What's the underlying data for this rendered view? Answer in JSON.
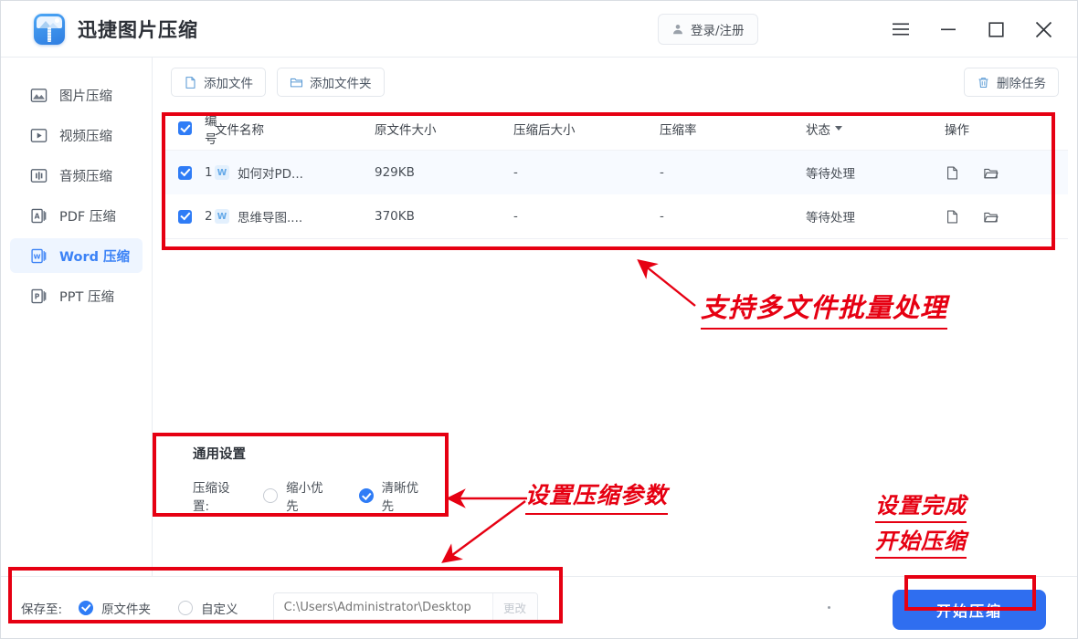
{
  "window": {
    "app_title": "迅捷图片压缩",
    "app_icon": "image-compress-app-icon",
    "login_label": "登录/注册",
    "login_icon": "user-icon",
    "controls": [
      {
        "name": "menu-button",
        "icon": "hamburger-icon"
      },
      {
        "name": "minimize-button",
        "icon": "minimize-icon"
      },
      {
        "name": "maximize-button",
        "icon": "maximize-icon"
      },
      {
        "name": "close-button",
        "icon": "close-icon"
      }
    ]
  },
  "sidebar": {
    "items": [
      {
        "label": "图片压缩",
        "icon": "image-icon",
        "active": false
      },
      {
        "label": "视频压缩",
        "icon": "video-play-icon",
        "active": false
      },
      {
        "label": "音频压缩",
        "icon": "audio-wave-icon",
        "active": false
      },
      {
        "label": "PDF 压缩",
        "icon": "pdf-file-icon",
        "active": false
      },
      {
        "label": "Word 压缩",
        "icon": "word-file-icon",
        "active": true
      },
      {
        "label": "PPT 压缩",
        "icon": "ppt-file-icon",
        "active": false
      }
    ]
  },
  "toolbar": {
    "add_file_label": "添加文件",
    "add_file_icon": "file-plus-icon",
    "add_folder_label": "添加文件夹",
    "add_folder_icon": "folder-icon",
    "delete_task_label": "删除任务",
    "delete_task_icon": "trash-icon"
  },
  "table": {
    "select_all_checked": true,
    "headers": {
      "no": "编号",
      "filename": "文件名称",
      "original_size": "原文件大小",
      "compressed_size": "压缩后大小",
      "ratio": "压缩率",
      "status": "状态",
      "action": "操作"
    },
    "status_sort_icon": "caret-down-icon",
    "rows": [
      {
        "checked": true,
        "no": "1",
        "file_icon": "word-doc-icon",
        "file_icon_letter": "W",
        "filename": "如何对PD...",
        "original_size": "929KB",
        "compressed_size": "-",
        "ratio": "-",
        "status": "等待处理",
        "actions": [
          "file-preview-icon",
          "open-folder-icon"
        ]
      },
      {
        "checked": true,
        "no": "2",
        "file_icon": "word-doc-icon",
        "file_icon_letter": "W",
        "filename": "思维导图....",
        "original_size": "370KB",
        "compressed_size": "-",
        "ratio": "-",
        "status": "等待处理",
        "actions": [
          "file-preview-icon",
          "open-folder-icon"
        ]
      }
    ]
  },
  "settings": {
    "title": "通用设置",
    "compress_label": "压缩设置:",
    "options": [
      {
        "label": "缩小优先",
        "selected": false
      },
      {
        "label": "清晰优先",
        "selected": true
      }
    ]
  },
  "bottom": {
    "save_to_label": "保存至:",
    "options": [
      {
        "label": "原文件夹",
        "selected": true
      },
      {
        "label": "自定义",
        "selected": false
      }
    ],
    "path_value": "",
    "path_placeholder": "C:\\Users\\Administrator\\Desktop",
    "change_label": "更改",
    "start_label": "开始压缩"
  },
  "annotations": {
    "color": "#e60012",
    "notes": [
      {
        "id": "ann1",
        "text": "支持多文件批量处理"
      },
      {
        "id": "ann2",
        "text": "设置压缩参数"
      },
      {
        "id": "ann3",
        "text": "设置完成"
      },
      {
        "id": "ann4",
        "text": "开始压缩"
      }
    ]
  }
}
